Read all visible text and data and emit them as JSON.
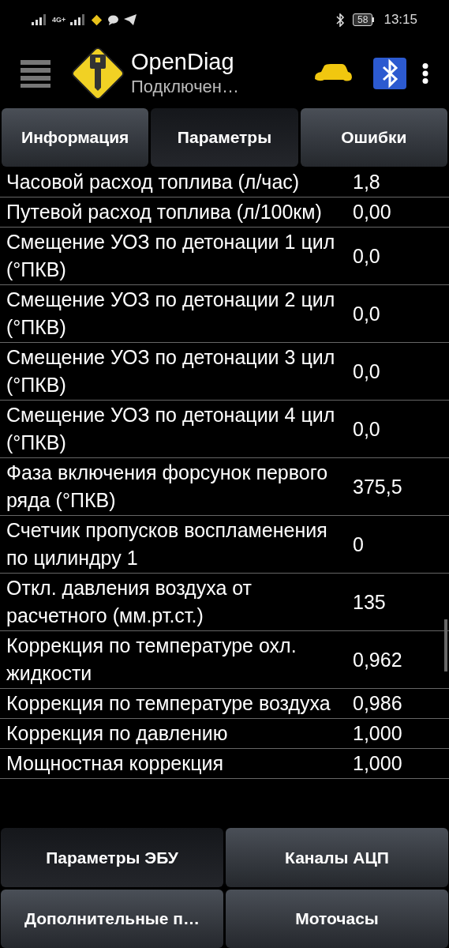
{
  "status_bar": {
    "network": "4G+",
    "battery": "58",
    "time": "13:15"
  },
  "app_bar": {
    "title": "OpenDiag",
    "subtitle": "Подключен…"
  },
  "tabs": [
    {
      "label": "Информация",
      "selected": false
    },
    {
      "label": "Параметры",
      "selected": true
    },
    {
      "label": "Ошибки",
      "selected": false
    }
  ],
  "parameters": [
    {
      "name": "Часовой расход топлива (л/час)",
      "value": "1,8"
    },
    {
      "name": "Путевой расход топлива (л/100км)",
      "value": "0,00"
    },
    {
      "name": "Смещение УОЗ по детонации 1 цил (°ПКВ)",
      "value": "0,0"
    },
    {
      "name": "Смещение УОЗ по детонации 2 цил (°ПКВ)",
      "value": "0,0"
    },
    {
      "name": "Смещение УОЗ по детонации 3 цил (°ПКВ)",
      "value": "0,0"
    },
    {
      "name": "Смещение УОЗ по детонации 4 цил (°ПКВ)",
      "value": "0,0"
    },
    {
      "name": "Фаза включения форсунок первого ряда (°ПКВ)",
      "value": "375,5"
    },
    {
      "name": "Счетчик пропусков воспламенения по цилиндру 1",
      "value": "0"
    },
    {
      "name": "Откл. давления воздуха от расчетного (мм.рт.ст.)",
      "value": "135"
    },
    {
      "name": "Коррекция по температуре охл. жидкости",
      "value": "0,962"
    },
    {
      "name": "Коррекция по температуре воздуха",
      "value": "0,986"
    },
    {
      "name": "Коррекция по давлению",
      "value": "1,000"
    },
    {
      "name": "Мощностная коррекция",
      "value": "1,000"
    }
  ],
  "bottom_buttons": [
    {
      "label": "Параметры ЭБУ",
      "selected": true
    },
    {
      "label": "Каналы АЦП",
      "selected": false
    },
    {
      "label": "Дополнительные п…",
      "selected": false
    },
    {
      "label": "Моточасы",
      "selected": false
    }
  ]
}
